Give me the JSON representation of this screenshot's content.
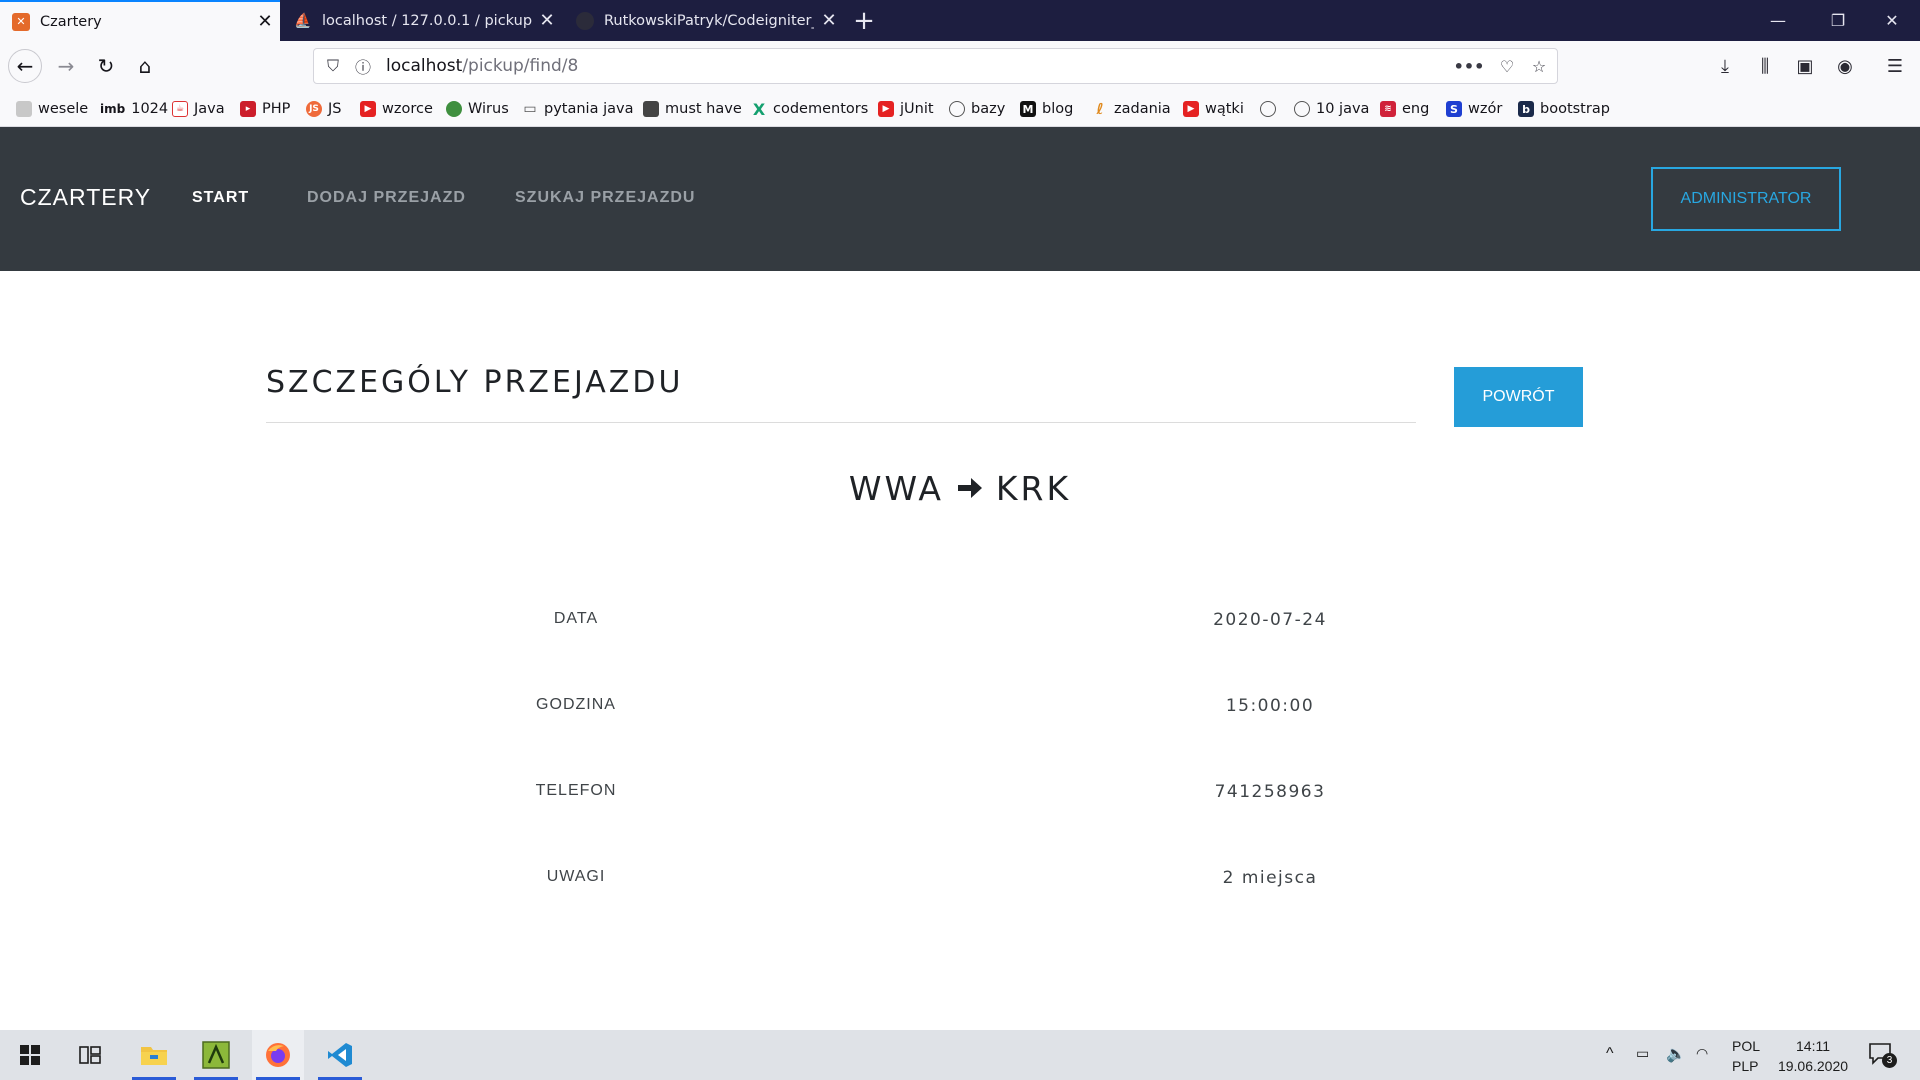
{
  "browser": {
    "tabs": [
      {
        "title": "Czartery",
        "active": true
      },
      {
        "title": "localhost / 127.0.0.1 / pickup / ",
        "active": false
      },
      {
        "title": "RutkowskiPatryk/Codeigniter_C",
        "active": false
      }
    ],
    "url": {
      "host": "localhost",
      "path": "/pickup/find/8"
    },
    "colors": {
      "tabstrip": "#1d1e40",
      "toolbar": "#f9f9fb",
      "active_tab_accent": "#0a84ff"
    }
  },
  "bookmarks": [
    {
      "label": "wesele",
      "icon": "page-icon"
    },
    {
      "label": "1024",
      "icon": "imb-icon",
      "prefix": "imb"
    },
    {
      "label": "Java",
      "icon": "java-icon"
    },
    {
      "label": "PHP",
      "icon": "php-icon"
    },
    {
      "label": "JS",
      "icon": "js-icon"
    },
    {
      "label": "wzorce",
      "icon": "youtube-icon"
    },
    {
      "label": "Wirus",
      "icon": "globe-icon"
    },
    {
      "label": "pytania java",
      "icon": "folder-icon"
    },
    {
      "label": "must have",
      "icon": "avatar-icon"
    },
    {
      "label": "codementors",
      "icon": "x-icon"
    },
    {
      "label": "jUnit",
      "icon": "youtube-icon"
    },
    {
      "label": "bazy",
      "icon": "globe-icon"
    },
    {
      "label": "blog",
      "icon": "medium-icon"
    },
    {
      "label": "zadania",
      "icon": "leetcode-icon"
    },
    {
      "label": "wątki",
      "icon": "youtube-icon"
    },
    {
      "label": "",
      "icon": "globe-icon"
    },
    {
      "label": "10 java",
      "icon": "globe-icon"
    },
    {
      "label": "eng",
      "icon": "wave-icon"
    },
    {
      "label": "wzór",
      "icon": "s-icon"
    },
    {
      "label": "bootstrap",
      "icon": "b-icon"
    }
  ],
  "site": {
    "brand": "CZARTERY",
    "nav": [
      {
        "label": "START",
        "active": true
      },
      {
        "label": "DODAJ PRZEJAZD",
        "active": false
      },
      {
        "label": "SZUKAJ PRZEJAZDU",
        "active": false
      }
    ],
    "admin_label": "ADMINISTRATOR",
    "colors": {
      "header_bg": "#343a40",
      "accent": "#259dd8"
    }
  },
  "content": {
    "title": "SZCZEGÓLY PRZEJAZDU",
    "back_label": "POWRÓT",
    "route": {
      "from": "WWA",
      "to": "KRK"
    },
    "details": [
      {
        "label": "DATA",
        "value": "2020-07-24"
      },
      {
        "label": "GODZINA",
        "value": "15:00:00"
      },
      {
        "label": "TELEFON",
        "value": "741258963"
      },
      {
        "label": "UWAGI",
        "value": "2 miejsca"
      }
    ]
  },
  "taskbar": {
    "apps": [
      {
        "name": "start-icon",
        "open": false
      },
      {
        "name": "task-view-icon",
        "open": false
      },
      {
        "name": "file-explorer-icon",
        "open": true
      },
      {
        "name": "xampp-icon",
        "open": true
      },
      {
        "name": "firefox-icon",
        "open": true
      },
      {
        "name": "vscode-icon",
        "open": true
      }
    ],
    "lang_top": "POL",
    "lang_bottom": "PLP",
    "time": "14:11",
    "date": "19.06.2020",
    "notifications": "3"
  }
}
